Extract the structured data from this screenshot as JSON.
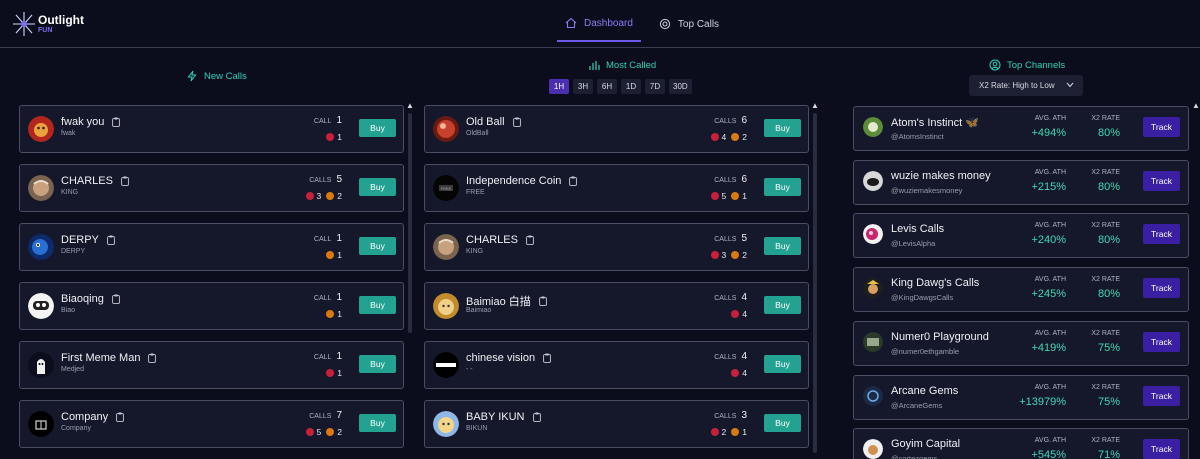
{
  "brand": {
    "name": "Outlight",
    "sub": "FUN"
  },
  "nav": [
    {
      "label": "Dashboard",
      "icon": "home-icon"
    },
    {
      "label": "Top Calls",
      "icon": "coin-icon"
    }
  ],
  "new_calls": {
    "title": "New Calls",
    "buy_label": "Buy",
    "items": [
      {
        "name": "fwak you",
        "symbol": "fwak",
        "calls_label": "CALL",
        "calls": "1",
        "red": "1",
        "orange": null
      },
      {
        "name": "CHARLES",
        "symbol": "KING",
        "calls_label": "CALLS",
        "calls": "5",
        "red": "3",
        "orange": "2"
      },
      {
        "name": "DERPY",
        "symbol": "DERPY",
        "calls_label": "CALL",
        "calls": "1",
        "red": null,
        "orange": "1"
      },
      {
        "name": "Biaoqing",
        "symbol": "Biao",
        "calls_label": "CALL",
        "calls": "1",
        "red": null,
        "orange": "1"
      },
      {
        "name": "First Meme Man",
        "symbol": "Medjed",
        "calls_label": "CALL",
        "calls": "1",
        "red": "1",
        "orange": null
      },
      {
        "name": "Company",
        "symbol": "Company",
        "calls_label": "CALLS",
        "calls": "7",
        "red": "5",
        "orange": "2"
      }
    ]
  },
  "most_called": {
    "title": "Most Called",
    "timeframes": [
      "1H",
      "3H",
      "6H",
      "1D",
      "7D",
      "30D"
    ],
    "active_timeframe": "1H",
    "buy_label": "Buy",
    "items": [
      {
        "name": "Old Ball",
        "symbol": "OldBall",
        "calls_label": "CALLS",
        "calls": "6",
        "red": "4",
        "orange": "2"
      },
      {
        "name": "Independence Coin",
        "symbol": "FREE",
        "calls_label": "CALLS",
        "calls": "6",
        "red": "5",
        "orange": "1"
      },
      {
        "name": "CHARLES",
        "symbol": "KING",
        "calls_label": "CALLS",
        "calls": "5",
        "red": "3",
        "orange": "2"
      },
      {
        "name": "Baimiao 白描",
        "symbol": "Baimiao",
        "calls_label": "CALLS",
        "calls": "4",
        "red": "4",
        "orange": null
      },
      {
        "name": "chinese vision",
        "symbol": "- -",
        "calls_label": "CALLS",
        "calls": "4",
        "red": "4",
        "orange": null
      },
      {
        "name": "BABY IKUN",
        "symbol": "BIKUN",
        "calls_label": "CALLS",
        "calls": "3",
        "red": "2",
        "orange": "1"
      }
    ]
  },
  "top_channels": {
    "title": "Top Channels",
    "sort_label": "X2 Rate: High to Low",
    "ath_label": "AVG. ATH",
    "x2_label": "X2 RATE",
    "track_label": "Track",
    "items": [
      {
        "name": "Atom's Instinct 🦋",
        "handle": "@AtomsInstinct",
        "ath": "+494%",
        "x2": "80%"
      },
      {
        "name": "wuzie makes money",
        "handle": "@wuziemakesmoney",
        "ath": "+215%",
        "x2": "80%"
      },
      {
        "name": "Levis Calls",
        "handle": "@LevisAlpha",
        "ath": "+240%",
        "x2": "80%"
      },
      {
        "name": "King Dawg's Calls",
        "handle": "@KingDawgsCalls",
        "ath": "+245%",
        "x2": "80%"
      },
      {
        "name": "Numer0 Playground",
        "handle": "@numer0ethgamble",
        "ath": "+419%",
        "x2": "75%"
      },
      {
        "name": "Arcane Gems",
        "handle": "@ArcaneGems",
        "ath": "+13979%",
        "x2": "75%"
      },
      {
        "name": "Goyim Capital",
        "handle": "@cortezgems",
        "ath": "+545%",
        "x2": "71%"
      }
    ]
  },
  "colors": {
    "background": "#0b0d1c",
    "card": "#15182a",
    "teal_accent": "#2fd1b8",
    "buy_button": "#23a291",
    "track_button": "#3b1fa3",
    "active_nav": "#8b7cf5",
    "red_dot": "#c8203c",
    "orange_dot": "#d97a10"
  }
}
